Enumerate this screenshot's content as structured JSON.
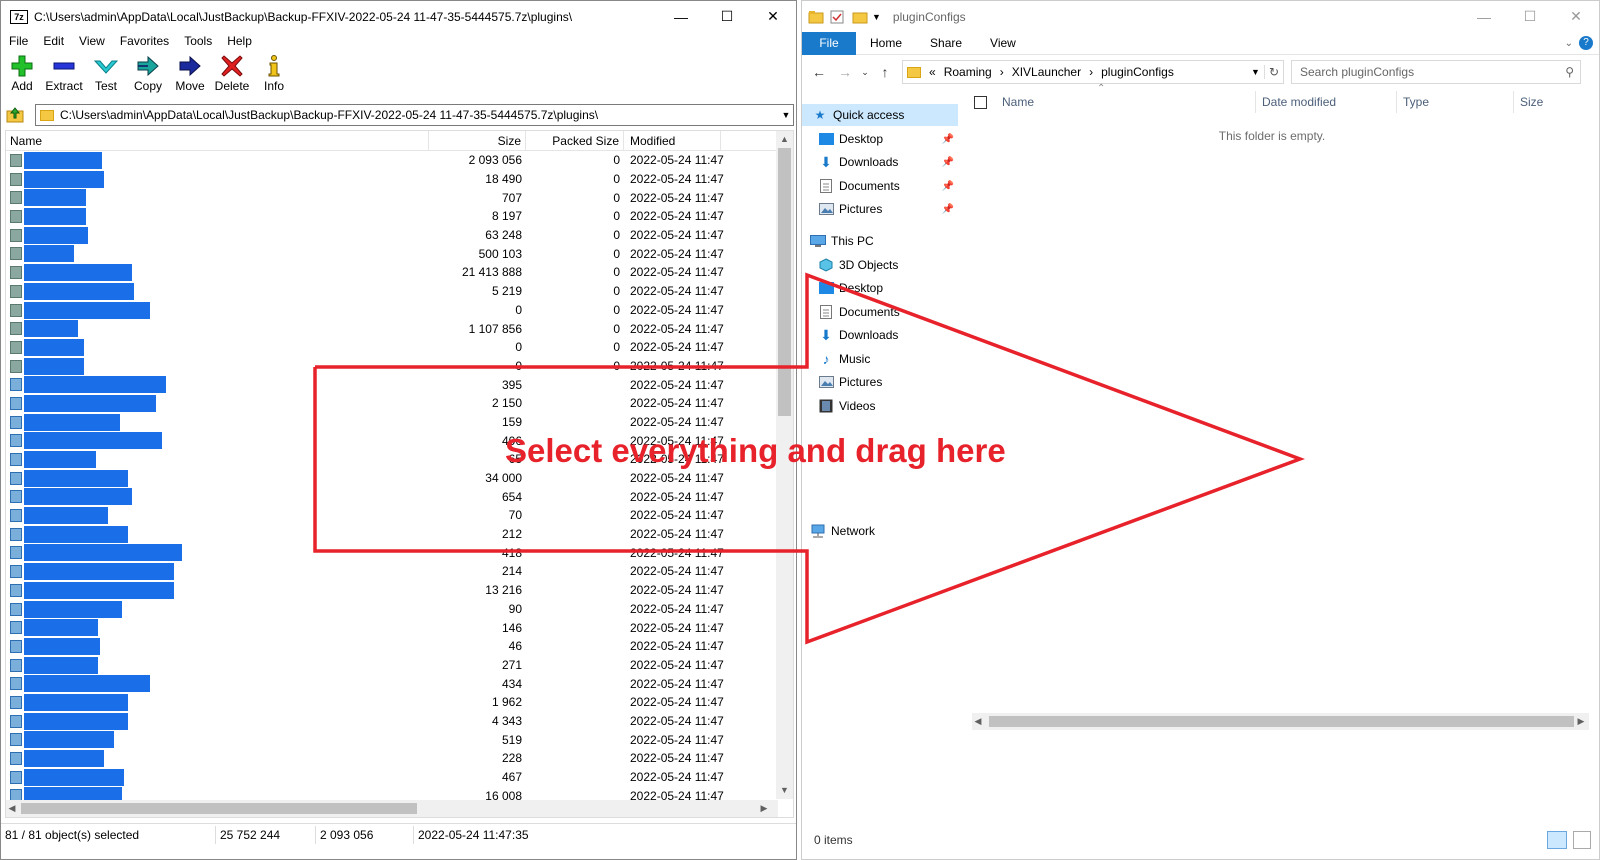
{
  "sevenzip": {
    "title": "C:\\Users\\admin\\AppData\\Local\\JustBackup\\Backup-FFXIV-2022-05-24 11-47-35-5444575.7z\\plugins\\",
    "logo": "7z",
    "menu": [
      "File",
      "Edit",
      "View",
      "Favorites",
      "Tools",
      "Help"
    ],
    "toolbar": [
      {
        "label": "Add",
        "icon": "plus-icon"
      },
      {
        "label": "Extract",
        "icon": "minus-icon"
      },
      {
        "label": "Test",
        "icon": "check-icon"
      },
      {
        "label": "Copy",
        "icon": "copy-arrow-icon"
      },
      {
        "label": "Move",
        "icon": "move-arrow-icon"
      },
      {
        "label": "Delete",
        "icon": "delete-x-icon"
      },
      {
        "label": "Info",
        "icon": "info-icon"
      }
    ],
    "address": "C:\\Users\\admin\\AppData\\Local\\JustBackup\\Backup-FFXIV-2022-05-24 11-47-35-5444575.7z\\plugins\\",
    "columns": {
      "name": "Name",
      "size": "Size",
      "packed": "Packed Size",
      "modified": "Modified"
    },
    "rows": [
      {
        "size": "2 093 056",
        "packed": "0",
        "modified": "2022-05-24 11:47",
        "folder": true
      },
      {
        "size": "18 490",
        "packed": "0",
        "modified": "2022-05-24 11:47",
        "folder": true
      },
      {
        "size": "707",
        "packed": "0",
        "modified": "2022-05-24 11:47",
        "folder": true
      },
      {
        "size": "8 197",
        "packed": "0",
        "modified": "2022-05-24 11:47",
        "folder": true
      },
      {
        "size": "63 248",
        "packed": "0",
        "modified": "2022-05-24 11:47",
        "folder": true
      },
      {
        "size": "500 103",
        "packed": "0",
        "modified": "2022-05-24 11:47",
        "folder": true
      },
      {
        "size": "21 413 888",
        "packed": "0",
        "modified": "2022-05-24 11:47",
        "folder": true
      },
      {
        "size": "5 219",
        "packed": "0",
        "modified": "2022-05-24 11:47",
        "folder": true
      },
      {
        "size": "0",
        "packed": "0",
        "modified": "2022-05-24 11:47",
        "folder": true
      },
      {
        "size": "1 107 856",
        "packed": "0",
        "modified": "2022-05-24 11:47",
        "folder": true
      },
      {
        "size": "0",
        "packed": "0",
        "modified": "2022-05-24 11:47",
        "folder": true
      },
      {
        "size": "0",
        "packed": "0",
        "modified": "2022-05-24 11:47",
        "folder": true
      },
      {
        "size": "395",
        "packed": "",
        "modified": "2022-05-24 11:47",
        "folder": false
      },
      {
        "size": "2 150",
        "packed": "",
        "modified": "2022-05-24 11:47",
        "folder": false
      },
      {
        "size": "159",
        "packed": "",
        "modified": "2022-05-24 11:47",
        "folder": false
      },
      {
        "size": "406",
        "packed": "",
        "modified": "2022-05-24 11:47",
        "folder": false
      },
      {
        "size": "65",
        "packed": "",
        "modified": "2022-05-24 11:47",
        "folder": false
      },
      {
        "size": "34 000",
        "packed": "",
        "modified": "2022-05-24 11:47",
        "folder": false
      },
      {
        "size": "654",
        "packed": "",
        "modified": "2022-05-24 11:47",
        "folder": false
      },
      {
        "size": "70",
        "packed": "",
        "modified": "2022-05-24 11:47",
        "folder": false
      },
      {
        "size": "212",
        "packed": "",
        "modified": "2022-05-24 11:47",
        "folder": false
      },
      {
        "size": "418",
        "packed": "",
        "modified": "2022-05-24 11:47",
        "folder": false
      },
      {
        "size": "214",
        "packed": "",
        "modified": "2022-05-24 11:47",
        "folder": false
      },
      {
        "size": "13 216",
        "packed": "",
        "modified": "2022-05-24 11:47",
        "folder": false
      },
      {
        "size": "90",
        "packed": "",
        "modified": "2022-05-24 11:47",
        "folder": false
      },
      {
        "size": "146",
        "packed": "",
        "modified": "2022-05-24 11:47",
        "folder": false
      },
      {
        "size": "46",
        "packed": "",
        "modified": "2022-05-24 11:47",
        "folder": false
      },
      {
        "size": "271",
        "packed": "",
        "modified": "2022-05-24 11:47",
        "folder": false
      },
      {
        "size": "434",
        "packed": "",
        "modified": "2022-05-24 11:47",
        "folder": false
      },
      {
        "size": "1 962",
        "packed": "",
        "modified": "2022-05-24 11:47",
        "folder": false
      },
      {
        "size": "4 343",
        "packed": "",
        "modified": "2022-05-24 11:47",
        "folder": false
      },
      {
        "size": "519",
        "packed": "",
        "modified": "2022-05-24 11:47",
        "folder": false
      },
      {
        "size": "228",
        "packed": "",
        "modified": "2022-05-24 11:47",
        "folder": false
      },
      {
        "size": "467",
        "packed": "",
        "modified": "2022-05-24 11:47",
        "folder": false
      },
      {
        "size": "16 008",
        "packed": "",
        "modified": "2022-05-24 11:47",
        "folder": false
      }
    ],
    "status": {
      "selected": "81 / 81 object(s) selected",
      "total_size": "25 752 244",
      "item_size": "2 093 056",
      "timestamp": "2022-05-24 11:47:35"
    }
  },
  "explorer": {
    "title": "pluginConfigs",
    "ribbon": {
      "file": "File",
      "tabs": [
        "Home",
        "Share",
        "View"
      ]
    },
    "breadcrumb": [
      "«",
      "Roaming",
      "›",
      "XIVLauncher",
      "›",
      "pluginConfigs"
    ],
    "search_placeholder": "Search pluginConfigs",
    "nav": {
      "quick_access": "Quick access",
      "quick_items": [
        "Desktop",
        "Downloads",
        "Documents",
        "Pictures"
      ],
      "this_pc": "This PC",
      "pc_items": [
        "3D Objects",
        "Desktop",
        "Documents",
        "Downloads",
        "Music",
        "Pictures",
        "Videos"
      ],
      "network": "Network"
    },
    "columns": [
      "Name",
      "Date modified",
      "Type",
      "Size"
    ],
    "empty_message": "This folder is empty.",
    "status": "0 items"
  },
  "annotation": {
    "text": "Select everything and drag here",
    "color": "#e8222b"
  }
}
